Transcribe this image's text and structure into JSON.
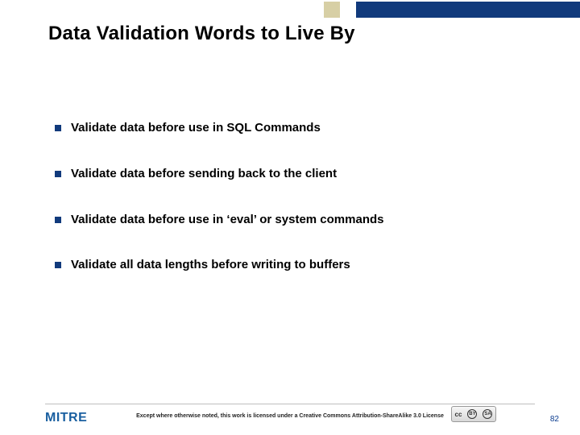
{
  "title": "Data Validation Words to Live By",
  "bullets": [
    "Validate data before use in SQL Commands",
    "Validate data before sending back to the client",
    "Validate data before use in ‘eval’ or system commands",
    "Validate all data lengths before writing to buffers"
  ],
  "logo_text": "MITRE",
  "license_text": "Except where otherwise noted, this work is licensed under a Creative Commons Attribution-ShareAlike 3.0 License",
  "cc": {
    "label": "cc"
  },
  "page_number": "82"
}
